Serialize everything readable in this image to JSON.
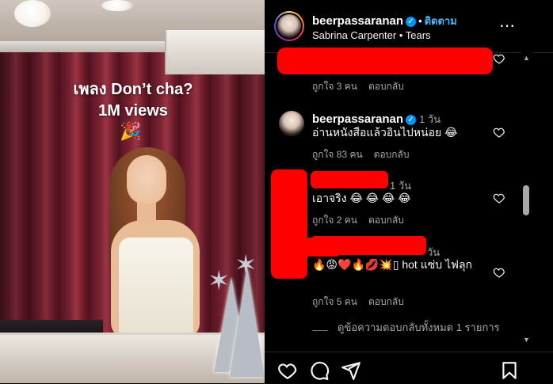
{
  "media": {
    "overlay_line1": "เพลง Don’t cha?",
    "overlay_line2": "1M views",
    "overlay_emoji": "🎉"
  },
  "header": {
    "username": "beerpassaranan",
    "verified_mark": "✓",
    "separator": "•",
    "follow_label": "ติดตาม",
    "subtitle": "Sabrina Carpenter • Tears",
    "more_label": "⋯"
  },
  "comments": [
    {
      "redacted": true,
      "likes_label": "ถูกใจ 3 คน",
      "reply_label": "ตอบกลับ"
    },
    {
      "username": "beerpassaranan",
      "verified_mark": "✓",
      "time": "1 วัน",
      "text": "อ่านหนังสือแล้วอินไปหน่อย 😂",
      "likes_label": "ถูกใจ 83 คน",
      "reply_label": "ตอบกลับ"
    },
    {
      "redacted": true,
      "time": "1 วัน",
      "text": "เอาจริง 😂 😂 😂 😂",
      "likes_label": "ถูกใจ 2 คน",
      "reply_label": "ตอบกลับ"
    },
    {
      "redacted": true,
      "time": "วัน",
      "text": "🔥😡❤️🔥💋💥▯ hot แซ่บ ไฟลุก",
      "likes_label": "ถูกใจ 5 คน",
      "reply_label": "ตอบกลับ"
    }
  ],
  "view_replies": "ดูข้อความตอบกลับทั้งหมด 1 รายการ",
  "scrollbar": {
    "up": "▲",
    "down": "▼"
  },
  "actions": [
    "heart-icon",
    "comment-icon",
    "share-icon",
    "bookmark-icon"
  ],
  "colors": {
    "accent": "#0095f6",
    "link": "#4cb5f9",
    "redaction": "#ff0000",
    "muted": "#a8a8a8"
  }
}
